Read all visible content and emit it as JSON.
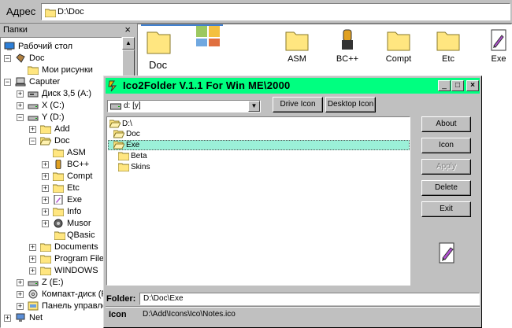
{
  "address": {
    "label": "Адрес",
    "path": "D:\\Doc"
  },
  "tree": {
    "title": "Папки",
    "close": "×",
    "nodes": [
      {
        "label": "Рабочий стол",
        "icon": "desktop-icon"
      },
      {
        "label": "Doc",
        "icon": "doc-folder-icon"
      },
      {
        "label": "Мои рисунки",
        "icon": "folder-icon"
      },
      {
        "label": "Caputer",
        "icon": "computer-icon"
      },
      {
        "label": "Диск 3,5 (A:)",
        "icon": "floppy-icon"
      },
      {
        "label": "X (C:)",
        "icon": "drive-icon"
      },
      {
        "label": "Y (D:)",
        "icon": "drive-icon"
      },
      {
        "label": "Add",
        "icon": "folder-icon"
      },
      {
        "label": "Doc",
        "icon": "folder-open-icon"
      },
      {
        "label": "ASM",
        "icon": "folder-icon"
      },
      {
        "label": "BC++",
        "icon": "bc-icon"
      },
      {
        "label": "Compt",
        "icon": "folder-icon"
      },
      {
        "label": "Etc",
        "icon": "folder-icon"
      },
      {
        "label": "Exe",
        "icon": "exe-icon"
      },
      {
        "label": "Info",
        "icon": "folder-icon"
      },
      {
        "label": "Musor",
        "icon": "musor-icon"
      },
      {
        "label": "QBasic",
        "icon": "folder-icon"
      },
      {
        "label": "Documents",
        "icon": "folder-icon"
      },
      {
        "label": "Program File",
        "icon": "folder-icon"
      },
      {
        "label": "WINDOWS",
        "icon": "folder-icon"
      },
      {
        "label": "Z (E:)",
        "icon": "drive-icon"
      },
      {
        "label": "Компакт-диск (F",
        "icon": "cd-icon"
      },
      {
        "label": "Панель управле",
        "icon": "control-panel-icon"
      },
      {
        "label": "Net",
        "icon": "net-icon"
      }
    ]
  },
  "fileview": {
    "header_title": "Doc",
    "items": [
      {
        "label": "ASM",
        "icon": "folder-icon"
      },
      {
        "label": "BC++",
        "icon": "bc-icon"
      },
      {
        "label": "Compt",
        "icon": "folder-icon"
      },
      {
        "label": "Etc",
        "icon": "folder-icon"
      },
      {
        "label": "Exe",
        "icon": "exe-icon"
      }
    ]
  },
  "dialog": {
    "title": "Ico2Folder V.1.1 For Win ME\\2000",
    "title_buttons": {
      "minimize": "_",
      "maximize": "□",
      "close": "×"
    },
    "drive_select": "d: [y]",
    "drive_icon_button": "Drive Icon",
    "desktop_icon_button": "Desktop Icon",
    "dirs": [
      {
        "label": "D:\\",
        "state": "open"
      },
      {
        "label": "Doc",
        "state": "open"
      },
      {
        "label": "Exe",
        "state": "selected"
      },
      {
        "label": "Beta",
        "state": "closed"
      },
      {
        "label": "Skins",
        "state": "closed"
      }
    ],
    "buttons": {
      "about": "About",
      "icon": "Icon",
      "apply": "Apply",
      "delete": "Delete",
      "exit": "Exit"
    },
    "folder_label": "Folder:",
    "folder_value": "D:\\Doc\\Exe",
    "icon_label": "Icon",
    "icon_value": "D:\\Add\\Icons\\Ico\\Notes.ico"
  },
  "colors": {
    "titlebar": "#00ff80",
    "selection": "#9bf0d8",
    "face": "#c0c0c0"
  }
}
